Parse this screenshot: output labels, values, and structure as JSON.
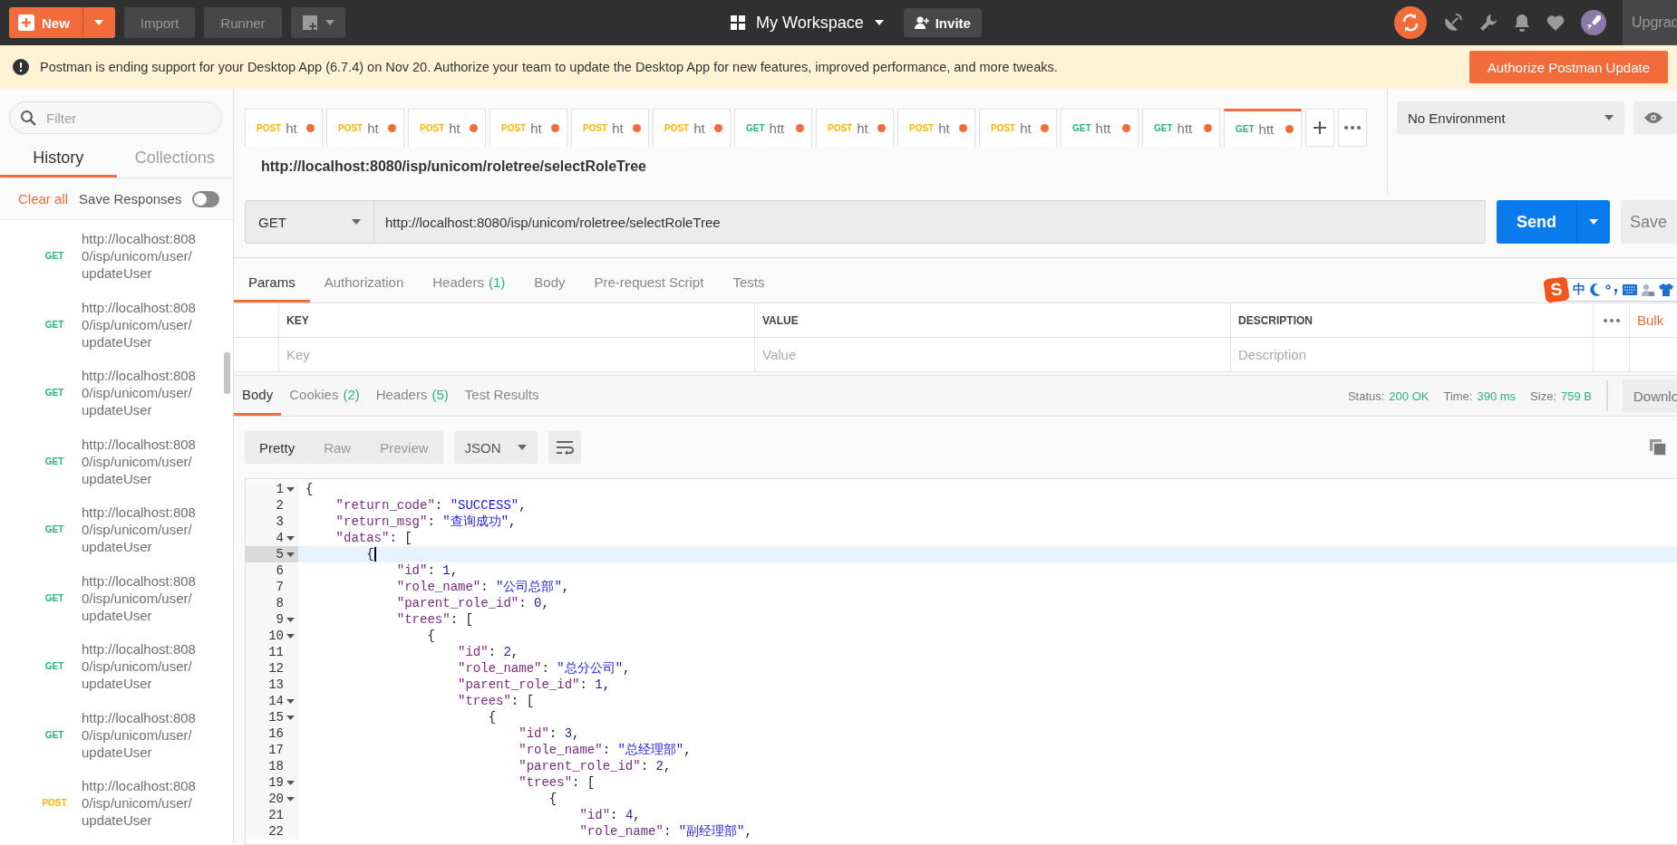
{
  "top_bar": {
    "new_button": "New",
    "import_button": "Import",
    "runner_button": "Runner",
    "workspace": "My Workspace",
    "invite_button": "Invite",
    "upgrade_button": "Upgrad"
  },
  "banner": {
    "message": "Postman is ending support for your Desktop App (6.7.4) on Nov 20. Authorize your team to update the Desktop App for new features, improved performance, and more tweaks.",
    "action_button": "Authorize Postman Update"
  },
  "sidebar": {
    "filter": {
      "placeholder": "Filter"
    },
    "tabs": [
      {
        "label": "History",
        "selected": true
      },
      {
        "label": "Collections",
        "selected": false
      }
    ],
    "clear_all": "Clear all",
    "save_responses": {
      "label": "Save Responses",
      "on": false
    },
    "history": [
      {
        "method": "GET",
        "url_lines": [
          "http://localhost:808",
          "0/isp/unicom/user/",
          "updateUser"
        ]
      },
      {
        "method": "GET",
        "url_lines": [
          "http://localhost:808",
          "0/isp/unicom/user/",
          "updateUser"
        ]
      },
      {
        "method": "GET",
        "url_lines": [
          "http://localhost:808",
          "0/isp/unicom/user/",
          "updateUser"
        ]
      },
      {
        "method": "GET",
        "url_lines": [
          "http://localhost:808",
          "0/isp/unicom/user/",
          "updateUser"
        ]
      },
      {
        "method": "GET",
        "url_lines": [
          "http://localhost:808",
          "0/isp/unicom/user/",
          "updateUser"
        ]
      },
      {
        "method": "GET",
        "url_lines": [
          "http://localhost:808",
          "0/isp/unicom/user/",
          "updateUser"
        ]
      },
      {
        "method": "GET",
        "url_lines": [
          "http://localhost:808",
          "0/isp/unicom/user/",
          "updateUser"
        ]
      },
      {
        "method": "GET",
        "url_lines": [
          "http://localhost:808",
          "0/isp/unicom/user/",
          "updateUser"
        ]
      },
      {
        "method": "POST",
        "url_lines": [
          "http://localhost:808",
          "0/isp/unicom/user/",
          "updateUser"
        ]
      }
    ]
  },
  "request_tabs": [
    {
      "method": "POST",
      "label": "ht",
      "unsaved": true,
      "selected": false
    },
    {
      "method": "POST",
      "label": "ht",
      "unsaved": true,
      "selected": false
    },
    {
      "method": "POST",
      "label": "ht",
      "unsaved": true,
      "selected": false
    },
    {
      "method": "POST",
      "label": "ht",
      "unsaved": true,
      "selected": false
    },
    {
      "method": "POST",
      "label": "ht",
      "unsaved": true,
      "selected": false
    },
    {
      "method": "POST",
      "label": "ht",
      "unsaved": true,
      "selected": false
    },
    {
      "method": "GET",
      "label": "htt",
      "unsaved": true,
      "selected": false
    },
    {
      "method": "POST",
      "label": "ht",
      "unsaved": true,
      "selected": false
    },
    {
      "method": "POST",
      "label": "ht",
      "unsaved": true,
      "selected": false
    },
    {
      "method": "POST",
      "label": "ht",
      "unsaved": true,
      "selected": false
    },
    {
      "method": "GET",
      "label": "htt",
      "unsaved": true,
      "selected": false
    },
    {
      "method": "GET",
      "label": "htt",
      "unsaved": true,
      "selected": false
    },
    {
      "method": "GET",
      "label": "htt",
      "unsaved": true,
      "selected": true
    }
  ],
  "environment": {
    "value": "No Environment"
  },
  "request": {
    "name": "http://localhost:8080/isp/unicom/roletree/selectRoleTree",
    "method": "GET",
    "url": "http://localhost:8080/isp/unicom/roletree/selectRoleTree",
    "send_button": "Send",
    "save_button": "Save"
  },
  "request_sections": [
    {
      "label": "Params",
      "selected": true
    },
    {
      "label": "Authorization",
      "selected": false
    },
    {
      "label": "Headers",
      "count": "(1)",
      "selected": false
    },
    {
      "label": "Body",
      "selected": false
    },
    {
      "label": "Pre-request Script",
      "selected": false
    },
    {
      "label": "Tests",
      "selected": false
    }
  ],
  "ime_toolbar": {
    "logo": "S",
    "mode": "中"
  },
  "params_table": {
    "columns": [
      "KEY",
      "VALUE",
      "DESCRIPTION"
    ],
    "bulk_edit": "Bulk",
    "placeholders": [
      "Key",
      "Value",
      "Description"
    ]
  },
  "response": {
    "tabs": [
      {
        "label": "Body",
        "selected": true
      },
      {
        "label": "Cookies",
        "count": "(2)",
        "selected": false
      },
      {
        "label": "Headers",
        "count": "(5)",
        "selected": false
      },
      {
        "label": "Test Results",
        "selected": false
      }
    ],
    "stats": [
      {
        "label": "Status:",
        "value": "200 OK"
      },
      {
        "label": "Time:",
        "value": "390 ms"
      },
      {
        "label": "Size:",
        "value": "759 B"
      }
    ],
    "download_button": "Downlo",
    "view_modes": [
      {
        "label": "Pretty",
        "selected": true
      },
      {
        "label": "Raw",
        "selected": false
      },
      {
        "label": "Preview",
        "selected": false
      }
    ],
    "format": "JSON",
    "code": [
      {
        "number": "1",
        "foldable": true,
        "selected": false,
        "tokens": [
          {
            "kind": "punct",
            "text": "{"
          }
        ]
      },
      {
        "number": "2",
        "foldable": false,
        "selected": false,
        "tokens": [
          {
            "kind": "key",
            "text": "    \"return_code\""
          },
          {
            "kind": "punct",
            "text": ": "
          },
          {
            "kind": "string",
            "text": "\"SUCCESS\""
          },
          {
            "kind": "punct",
            "text": ","
          }
        ]
      },
      {
        "number": "3",
        "foldable": false,
        "selected": false,
        "tokens": [
          {
            "kind": "key",
            "text": "    \"return_msg\""
          },
          {
            "kind": "punct",
            "text": ": "
          },
          {
            "kind": "string",
            "text": "\"查询成功\""
          },
          {
            "kind": "punct",
            "text": ","
          }
        ]
      },
      {
        "number": "4",
        "foldable": true,
        "selected": false,
        "tokens": [
          {
            "kind": "key",
            "text": "    \"datas\""
          },
          {
            "kind": "punct",
            "text": ": ["
          }
        ]
      },
      {
        "number": "5",
        "foldable": true,
        "selected": true,
        "tokens": [
          {
            "kind": "punct",
            "text": "        {"
          }
        ]
      },
      {
        "number": "6",
        "foldable": false,
        "selected": false,
        "tokens": [
          {
            "kind": "key",
            "text": "            \"id\""
          },
          {
            "kind": "punct",
            "text": ": "
          },
          {
            "kind": "number",
            "text": "1"
          },
          {
            "kind": "punct",
            "text": ","
          }
        ]
      },
      {
        "number": "7",
        "foldable": false,
        "selected": false,
        "tokens": [
          {
            "kind": "key",
            "text": "            \"role_name\""
          },
          {
            "kind": "punct",
            "text": ": "
          },
          {
            "kind": "string",
            "text": "\"公司总部\""
          },
          {
            "kind": "punct",
            "text": ","
          }
        ]
      },
      {
        "number": "8",
        "foldable": false,
        "selected": false,
        "tokens": [
          {
            "kind": "key",
            "text": "            \"parent_role_id\""
          },
          {
            "kind": "punct",
            "text": ": "
          },
          {
            "kind": "number",
            "text": "0"
          },
          {
            "kind": "punct",
            "text": ","
          }
        ]
      },
      {
        "number": "9",
        "foldable": true,
        "selected": false,
        "tokens": [
          {
            "kind": "key",
            "text": "            \"trees\""
          },
          {
            "kind": "punct",
            "text": ": ["
          }
        ]
      },
      {
        "number": "10",
        "foldable": true,
        "selected": false,
        "tokens": [
          {
            "kind": "punct",
            "text": "                {"
          }
        ]
      },
      {
        "number": "11",
        "foldable": false,
        "selected": false,
        "tokens": [
          {
            "kind": "key",
            "text": "                    \"id\""
          },
          {
            "kind": "punct",
            "text": ": "
          },
          {
            "kind": "number",
            "text": "2"
          },
          {
            "kind": "punct",
            "text": ","
          }
        ]
      },
      {
        "number": "12",
        "foldable": false,
        "selected": false,
        "tokens": [
          {
            "kind": "key",
            "text": "                    \"role_name\""
          },
          {
            "kind": "punct",
            "text": ": "
          },
          {
            "kind": "string",
            "text": "\"总分公司\""
          },
          {
            "kind": "punct",
            "text": ","
          }
        ]
      },
      {
        "number": "13",
        "foldable": false,
        "selected": false,
        "tokens": [
          {
            "kind": "key",
            "text": "                    \"parent_role_id\""
          },
          {
            "kind": "punct",
            "text": ": "
          },
          {
            "kind": "number",
            "text": "1"
          },
          {
            "kind": "punct",
            "text": ","
          }
        ]
      },
      {
        "number": "14",
        "foldable": true,
        "selected": false,
        "tokens": [
          {
            "kind": "key",
            "text": "                    \"trees\""
          },
          {
            "kind": "punct",
            "text": ": ["
          }
        ]
      },
      {
        "number": "15",
        "foldable": true,
        "selected": false,
        "tokens": [
          {
            "kind": "punct",
            "text": "                        {"
          }
        ]
      },
      {
        "number": "16",
        "foldable": false,
        "selected": false,
        "tokens": [
          {
            "kind": "key",
            "text": "                            \"id\""
          },
          {
            "kind": "punct",
            "text": ": "
          },
          {
            "kind": "number",
            "text": "3"
          },
          {
            "kind": "punct",
            "text": ","
          }
        ]
      },
      {
        "number": "17",
        "foldable": false,
        "selected": false,
        "tokens": [
          {
            "kind": "key",
            "text": "                            \"role_name\""
          },
          {
            "kind": "punct",
            "text": ": "
          },
          {
            "kind": "string",
            "text": "\"总经理部\""
          },
          {
            "kind": "punct",
            "text": ","
          }
        ]
      },
      {
        "number": "18",
        "foldable": false,
        "selected": false,
        "tokens": [
          {
            "kind": "key",
            "text": "                            \"parent_role_id\""
          },
          {
            "kind": "punct",
            "text": ": "
          },
          {
            "kind": "number",
            "text": "2"
          },
          {
            "kind": "punct",
            "text": ","
          }
        ]
      },
      {
        "number": "19",
        "foldable": true,
        "selected": false,
        "tokens": [
          {
            "kind": "key",
            "text": "                            \"trees\""
          },
          {
            "kind": "punct",
            "text": ": ["
          }
        ]
      },
      {
        "number": "20",
        "foldable": true,
        "selected": false,
        "tokens": [
          {
            "kind": "punct",
            "text": "                                {"
          }
        ]
      },
      {
        "number": "21",
        "foldable": false,
        "selected": false,
        "tokens": [
          {
            "kind": "key",
            "text": "                                    \"id\""
          },
          {
            "kind": "punct",
            "text": ": "
          },
          {
            "kind": "number",
            "text": "4"
          },
          {
            "kind": "punct",
            "text": ","
          }
        ]
      },
      {
        "number": "22",
        "foldable": false,
        "selected": false,
        "tokens": [
          {
            "kind": "key",
            "text": "                                    \"role_name\""
          },
          {
            "kind": "punct",
            "text": ": "
          },
          {
            "kind": "string",
            "text": "\"副经理部\""
          },
          {
            "kind": "punct",
            "text": ","
          }
        ]
      }
    ]
  }
}
